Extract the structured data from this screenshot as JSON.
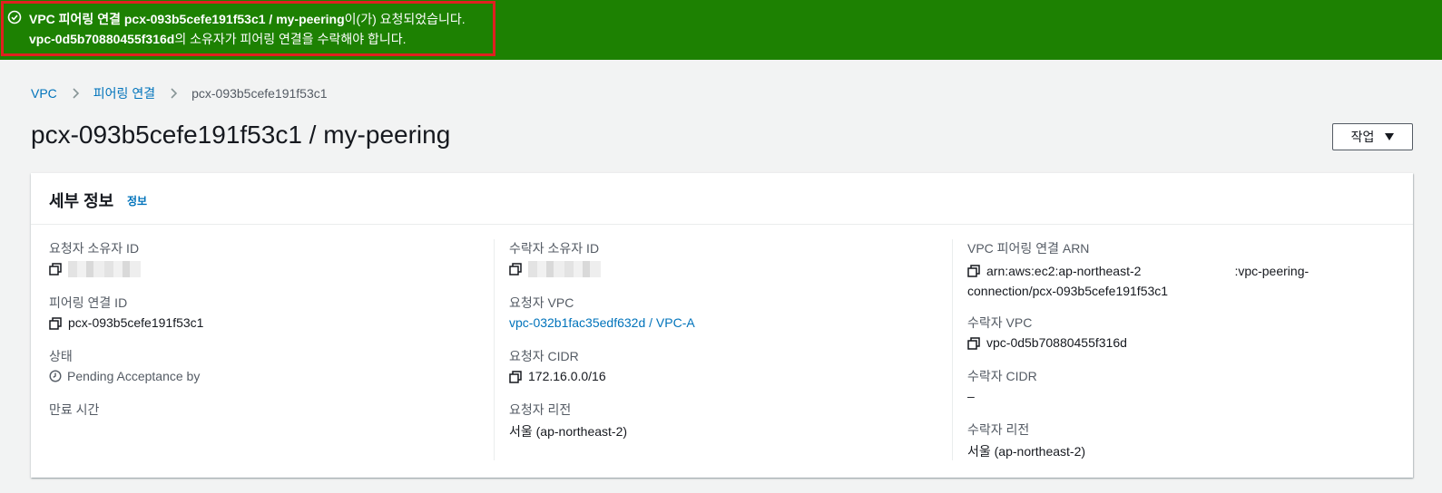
{
  "flash": {
    "line1_prefix": "VPC 피어링 연결 pcx-093b5cefe191f53c1 / my-peering",
    "line1_suffix": "이(가) 요청되었습니다.",
    "line2_vpc": "vpc-0d5b70880455f316d",
    "line2_suffix": "의 소유자가 피어링 연결을 수락해야 합니다.",
    "icon": "check-circle-icon",
    "bg_color": "#1d8102"
  },
  "breadcrumb": {
    "items": [
      {
        "label": "VPC"
      },
      {
        "label": "피어링 연결"
      },
      {
        "label": "pcx-093b5cefe191f53c1"
      }
    ]
  },
  "page": {
    "title": "pcx-093b5cefe191f53c1 / my-peering",
    "action_label": "작업"
  },
  "panel": {
    "title": "세부 정보",
    "info_link": "정보"
  },
  "details": {
    "requester_owner_id": {
      "label": "요청자 소유자 ID"
    },
    "peering_id": {
      "label": "피어링 연결 ID",
      "value": "pcx-093b5cefe191f53c1"
    },
    "status": {
      "label": "상태",
      "value": "Pending Acceptance by"
    },
    "expiry": {
      "label": "만료 시간"
    },
    "accepter_owner_id": {
      "label": "수락자 소유자 ID"
    },
    "requester_vpc": {
      "label": "요청자 VPC",
      "value": "vpc-032b1fac35edf632d / VPC-A"
    },
    "requester_cidr": {
      "label": "요청자 CIDR",
      "value": "172.16.0.0/16"
    },
    "requester_region": {
      "label": "요청자 리전",
      "value": "서울 (ap-northeast-2)"
    },
    "arn": {
      "label": "VPC 피어링 연결 ARN",
      "value_part1": "arn:aws:ec2:ap-northeast-2",
      "value_part2": ":vpc-peering-",
      "value_part3": "connection/pcx-093b5cefe191f53c1"
    },
    "accepter_vpc": {
      "label": "수락자 VPC",
      "value": "vpc-0d5b70880455f316d"
    },
    "accepter_cidr": {
      "label": "수락자 CIDR",
      "value": "–"
    },
    "accepter_region": {
      "label": "수락자 리전",
      "value": "서울 (ap-northeast-2)"
    }
  }
}
